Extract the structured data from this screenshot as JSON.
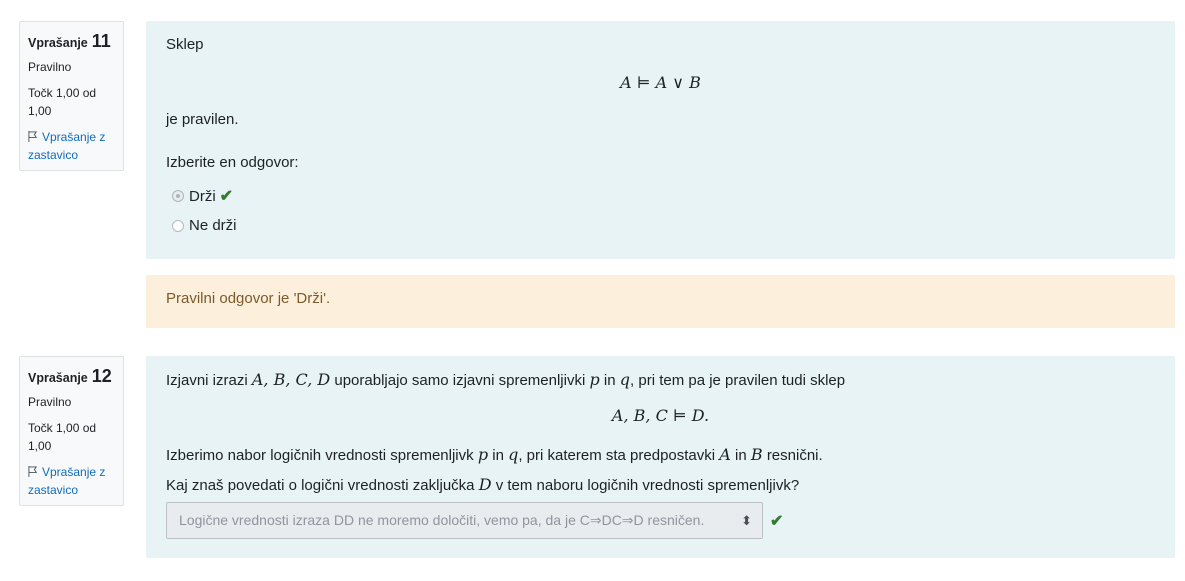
{
  "q11": {
    "label": "Vprašanje",
    "number": "11",
    "state": "Pravilno",
    "grade": "Točk 1,00 od 1,00",
    "flag": "Vprašanje z zastavico",
    "intro": "Sklep",
    "formula": "A ⊨ A ∨ B",
    "after": "je pravilen.",
    "prompt": "Izberite en odgovor:",
    "options": [
      {
        "label": "Drži",
        "selected": true,
        "correct": true
      },
      {
        "label": "Ne drži",
        "selected": false,
        "correct": false
      }
    ],
    "feedback": "Pravilni odgovor je 'Drži'."
  },
  "q12": {
    "label": "Vprašanje",
    "number": "12",
    "state": "Pravilno",
    "grade": "Točk 1,00 od 1,00",
    "flag": "Vprašanje z zastavico",
    "line1_a": "Izjavni izrazi",
    "line1_vars": "A, B, C, D",
    "line1_b": "uporabljajo samo izjavni spremenljivki",
    "var_p": "p",
    "word_in": "in",
    "var_q": "q",
    "line1_c": ", pri tem pa je pravilen tudi sklep",
    "formula": "A, B, C ⊨ D.",
    "line2_a": "Izberimo nabor logičnih vrednosti spremenljivk",
    "line2_b": ", pri katerem sta predpostavki",
    "var_A": "A",
    "var_B": "B",
    "line2_c": "resnični.",
    "line3_a": "Kaj znaš povedati o logični vrednosti zaključka",
    "var_D": "D",
    "line3_b": "v tem naboru logičnih vrednosti spremenljivk?",
    "select_value": "Logične vrednosti izraza DD ne moremo določiti, vemo pa, da je C⇒DC⇒D resničen."
  },
  "colors": {
    "correct": "#357a32",
    "link": "#0f6cbf",
    "content_bg": "#e7f3f5",
    "feedback_bg": "#fcefdc"
  }
}
